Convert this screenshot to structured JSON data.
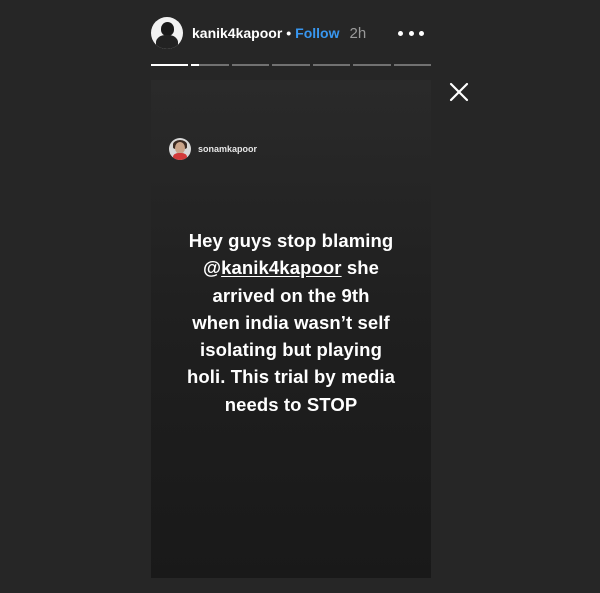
{
  "header": {
    "username": "kanik4kapoor",
    "separator": "•",
    "follow_label": "Follow",
    "time_ago": "2h",
    "more_icon": "more-horizontal-icon",
    "close_icon": "close-icon"
  },
  "progress": {
    "segments_total": 7,
    "current_segment": 2,
    "current_fraction": 0.2
  },
  "story": {
    "reshared_from": "sonamkapoor",
    "message_lines": [
      {
        "before": "Hey guys stop blaming",
        "mention": "",
        "after": ""
      },
      {
        "before": "@",
        "mention": "kanik4kapoor",
        "after": " she"
      },
      {
        "before": "arrived on the 9th",
        "mention": "",
        "after": ""
      },
      {
        "before": "when india wasn’t self",
        "mention": "",
        "after": ""
      },
      {
        "before": "isolating but playing",
        "mention": "",
        "after": ""
      },
      {
        "before": "holi. This trial by media",
        "mention": "",
        "after": ""
      },
      {
        "before": "needs to STOP",
        "mention": "",
        "after": ""
      }
    ]
  },
  "colors": {
    "background": "#262626",
    "follow_blue": "#3897f0",
    "text": "#ffffff",
    "muted": "#9a9a9a"
  }
}
